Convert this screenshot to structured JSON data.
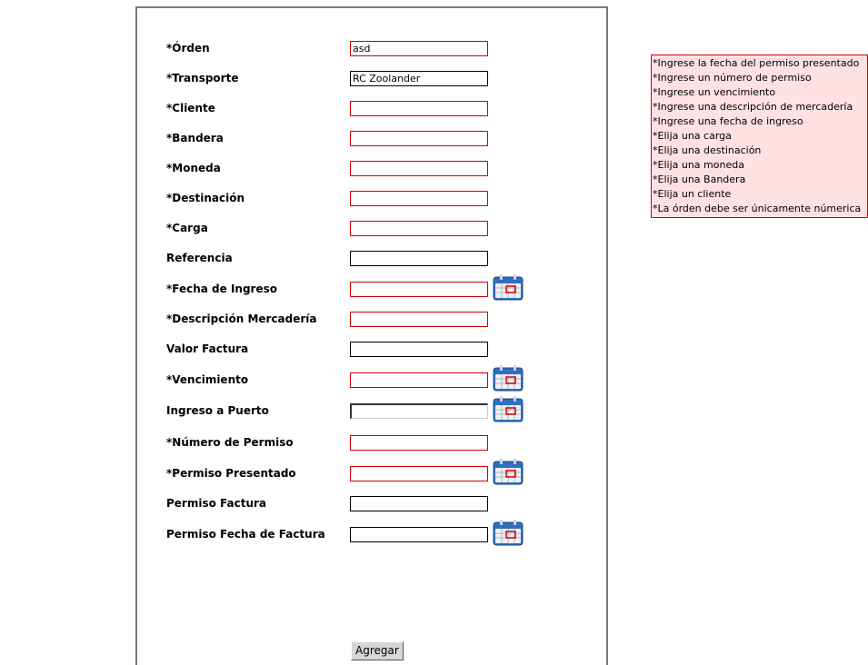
{
  "form": {
    "fields": [
      {
        "label": "*Órden",
        "value": "asd",
        "state": "invalid"
      },
      {
        "label": "*Transporte",
        "value": "RC Zoolander",
        "state": "normal"
      },
      {
        "label": "*Cliente",
        "value": "",
        "state": "invalid"
      },
      {
        "label": "*Bandera",
        "value": "",
        "state": "invalid"
      },
      {
        "label": "*Moneda",
        "value": "",
        "state": "invalid"
      },
      {
        "label": "*Destinación",
        "value": "",
        "state": "invalid"
      },
      {
        "label": "*Carga",
        "value": "",
        "state": "invalid"
      },
      {
        "label": "Referencia",
        "value": "",
        "state": "normal"
      },
      {
        "label": "*Fecha de Ingreso",
        "value": "",
        "state": "invalid",
        "calendar": true
      },
      {
        "label": "*Descripción Mercadería",
        "value": "",
        "state": "invalid"
      },
      {
        "label": "Valor Factura",
        "value": "",
        "state": "normal"
      },
      {
        "label": "*Vencimiento",
        "value": "",
        "state": "invalid",
        "calendar": true
      },
      {
        "label": "Ingreso a Puerto",
        "value": "",
        "state": "sunken",
        "calendar": true
      },
      {
        "label": "*Número de Permiso",
        "value": "",
        "state": "invalid"
      },
      {
        "label": "*Permiso Presentado",
        "value": "",
        "state": "invalid",
        "calendar": true
      },
      {
        "label": "Permiso Factura",
        "value": "",
        "state": "normal"
      },
      {
        "label": "Permiso Fecha de Factura",
        "value": "",
        "state": "normal",
        "calendar": true
      }
    ],
    "submit_label": "Agregar",
    "calendar_icon": "calendar-icon"
  },
  "errors": [
    "*Ingrese la fecha del permiso presentado",
    "*Ingrese un número de permiso",
    "*Ingrese un vencimiento",
    "*Ingrese una descripción de mercadería",
    "*Ingrese una fecha de ingreso",
    "*Elija una carga",
    "*Elija una destinación",
    "*Elija una moneda",
    "*Elija una Bandera",
    "*Elija un cliente",
    "*La órden debe ser únicamente númerica"
  ],
  "colors": {
    "invalid_border": "#d00000",
    "error_background": "#ffe0e3",
    "calendar_blue": "#2f6fbf"
  }
}
